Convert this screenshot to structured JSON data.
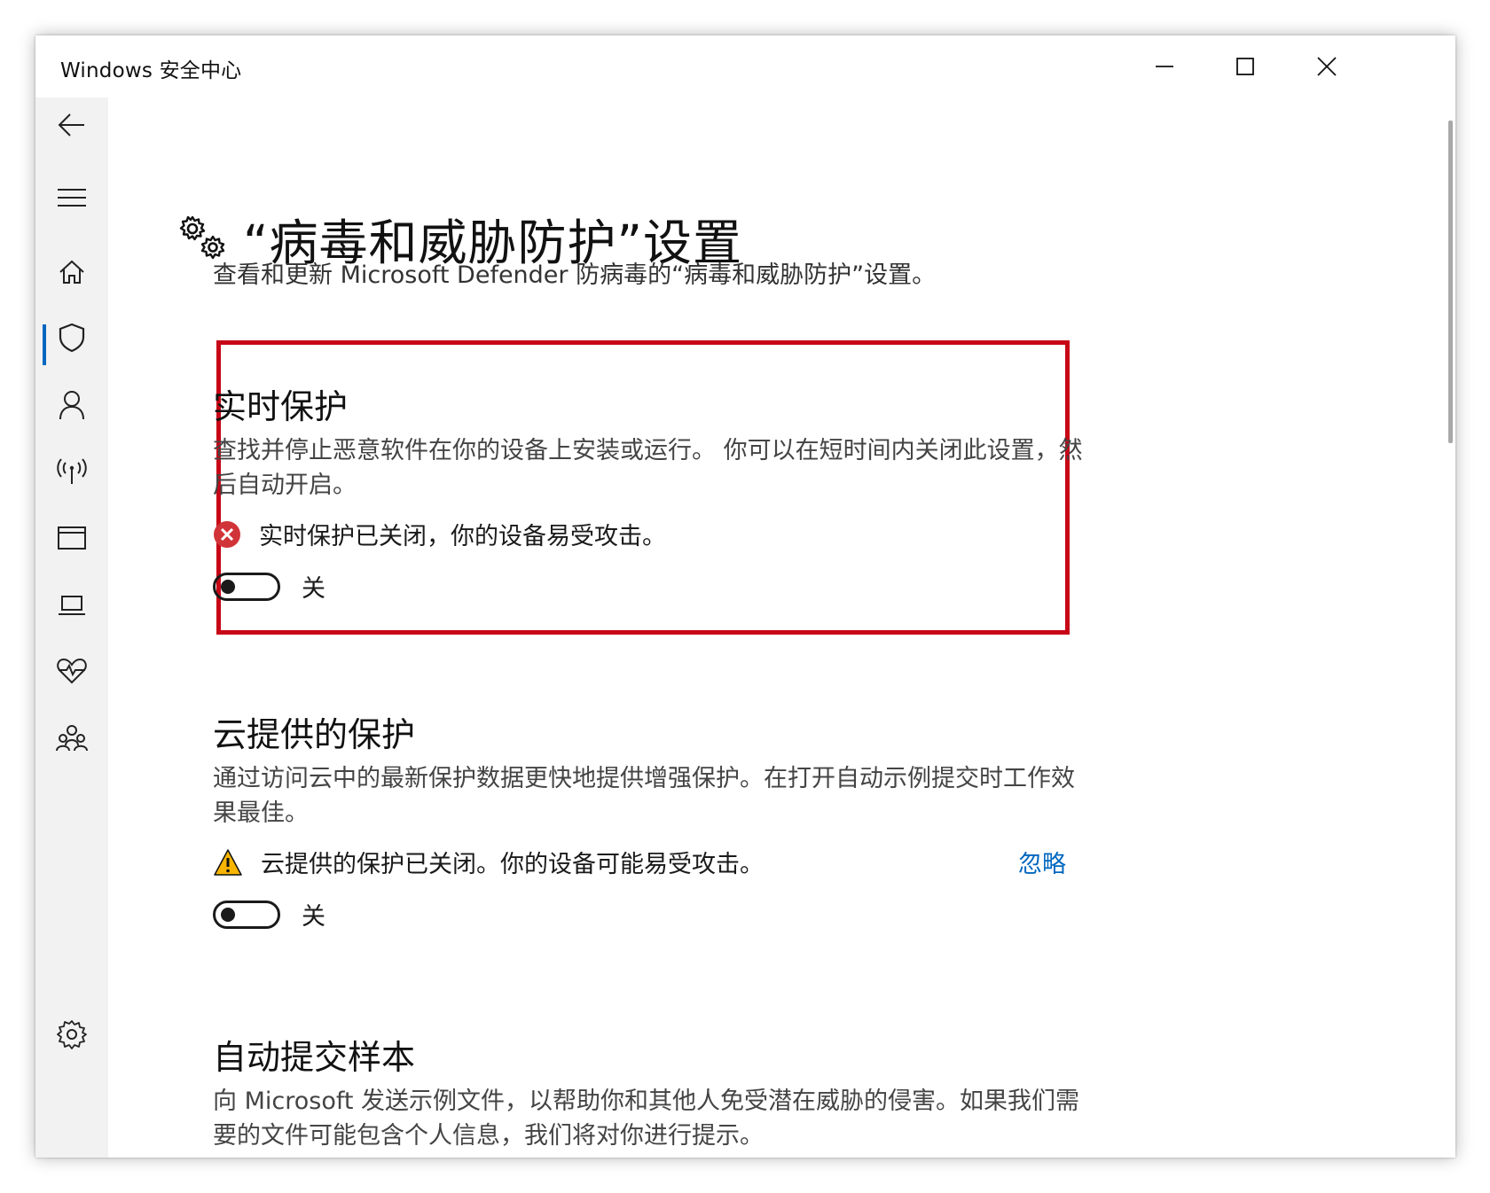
{
  "window": {
    "title": "Windows 安全中心",
    "minimize_label": "最小化",
    "maximize_label": "最大化",
    "close_label": "关闭"
  },
  "sidebar": {
    "items": [
      {
        "id": "back",
        "icon": "back-arrow-icon"
      },
      {
        "id": "menu",
        "icon": "hamburger-icon"
      },
      {
        "id": "home",
        "icon": "home-icon"
      },
      {
        "id": "virus",
        "icon": "shield-icon",
        "selected": true
      },
      {
        "id": "account",
        "icon": "person-icon"
      },
      {
        "id": "firewall",
        "icon": "antenna-icon"
      },
      {
        "id": "app-browser",
        "icon": "browser-window-icon"
      },
      {
        "id": "device-security",
        "icon": "laptop-icon"
      },
      {
        "id": "device-health",
        "icon": "heart-icon"
      },
      {
        "id": "family",
        "icon": "family-icon"
      },
      {
        "id": "settings",
        "icon": "gear-icon"
      }
    ],
    "accent_color": "#0067c0"
  },
  "page": {
    "title": "“病毒和威胁防护”设置",
    "subtitle": "查看和更新 Microsoft Defender 防病毒的“病毒和威胁防护”设置。"
  },
  "realtime": {
    "title": "实时保护",
    "description": "查找并停止恶意软件在你的设备上安装或运行。 你可以在短时间内关闭此设置，然后自动开启。",
    "status": "实时保护已关闭，你的设备易受攻击。",
    "status_icon": "error-x-icon",
    "status_color": "#d13438",
    "toggle_state": "关",
    "highlight_color": "#c70617"
  },
  "cloud": {
    "title": "云提供的保护",
    "description": "通过访问云中的最新保护数据更快地提供增强保护。在打开自动示例提交时工作效果最佳。",
    "status": "云提供的保护已关闭。你的设备可能易受攻击。",
    "status_icon": "warning-triangle-icon",
    "status_color": "#f7b500",
    "dismiss": "忽略",
    "toggle_state": "关"
  },
  "sample": {
    "title": "自动提交样本",
    "description": "向 Microsoft 发送示例文件，以帮助你和其他人免受潜在威胁的侵害。如果我们需要的文件可能包含个人信息，我们将对你进行提示。"
  }
}
